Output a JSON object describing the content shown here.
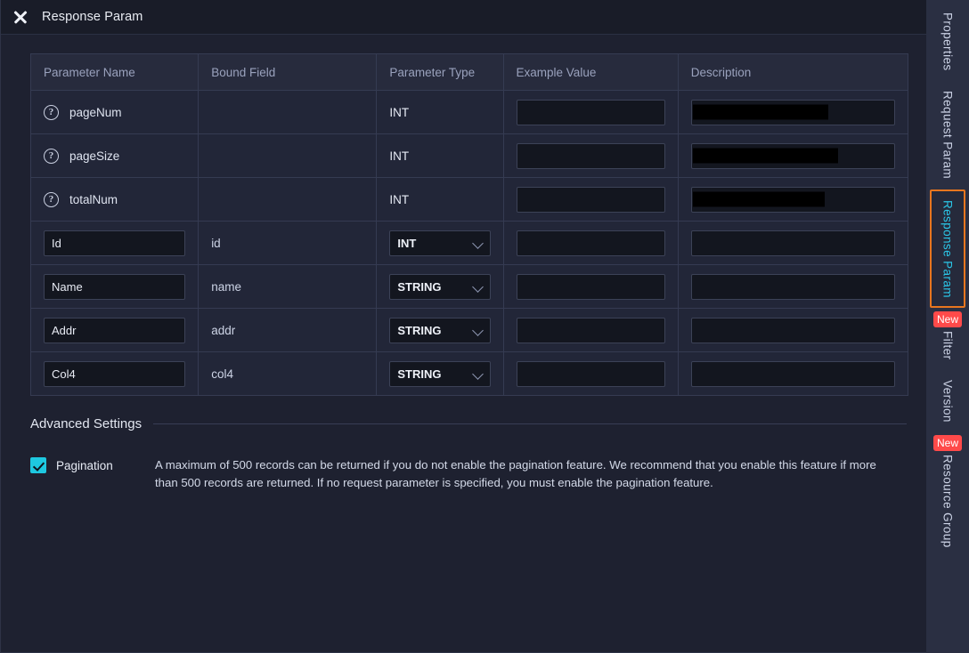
{
  "titlebar": {
    "close_icon": "close-icon",
    "title": "Response Param"
  },
  "table": {
    "headers": [
      "Parameter Name",
      "Bound Field",
      "Parameter Type",
      "Example Value",
      "Description"
    ],
    "rows": [
      {
        "kind": "readonly",
        "help_icon": "help-circle-icon",
        "name": "pageNum",
        "bound": "",
        "type": "INT",
        "example": "",
        "description": "",
        "description_redacted": true,
        "redact_width": 152
      },
      {
        "kind": "readonly",
        "help_icon": "help-circle-icon",
        "name": "pageSize",
        "bound": "",
        "type": "INT",
        "example": "",
        "description": "",
        "description_redacted": true,
        "redact_width": 163
      },
      {
        "kind": "readonly",
        "help_icon": "help-circle-icon",
        "name": "totalNum",
        "bound": "",
        "type": "INT",
        "example": "",
        "description": "",
        "description_redacted": true,
        "redact_width": 148
      },
      {
        "kind": "editable",
        "name": "Id",
        "bound": "id",
        "type": "INT",
        "example": "",
        "description": "",
        "description_redacted": false,
        "redact_width": 0
      },
      {
        "kind": "editable",
        "name": "Name",
        "bound": "name",
        "type": "STRING",
        "example": "",
        "description": "",
        "description_redacted": false,
        "redact_width": 0
      },
      {
        "kind": "editable",
        "name": "Addr",
        "bound": "addr",
        "type": "STRING",
        "example": "",
        "description": "",
        "description_redacted": false,
        "redact_width": 0
      },
      {
        "kind": "editable",
        "name": "Col4",
        "bound": "col4",
        "type": "STRING",
        "example": "",
        "description": "",
        "description_redacted": false,
        "redact_width": 0
      }
    ]
  },
  "advanced": {
    "title": "Advanced Settings",
    "pagination_label": "Pagination",
    "pagination_checked": true,
    "pagination_description": "A maximum of 500 records can be returned if you do not enable the pagination feature. We recommend that you enable this feature if more than 500 records are returned. If no request parameter is specified, you must enable the pagination feature."
  },
  "rail": {
    "tabs": [
      {
        "label": "Properties",
        "active": false,
        "badge": ""
      },
      {
        "label": "Request Param",
        "active": false,
        "badge": ""
      },
      {
        "label": "Response Param",
        "active": true,
        "badge": ""
      },
      {
        "label": "Filter",
        "active": false,
        "badge": "New"
      },
      {
        "label": "Version",
        "active": false,
        "badge": ""
      },
      {
        "label": "Resource Group",
        "active": false,
        "badge": "New"
      }
    ]
  },
  "colors": {
    "accent_active_border": "#e8761f",
    "accent_active_text": "#2bc7e8",
    "badge_red": "#ff4a4a",
    "checkbox_cyan": "#1ec8e0",
    "panel_bg": "#1e2130",
    "table_header_bg": "#272b3d"
  }
}
